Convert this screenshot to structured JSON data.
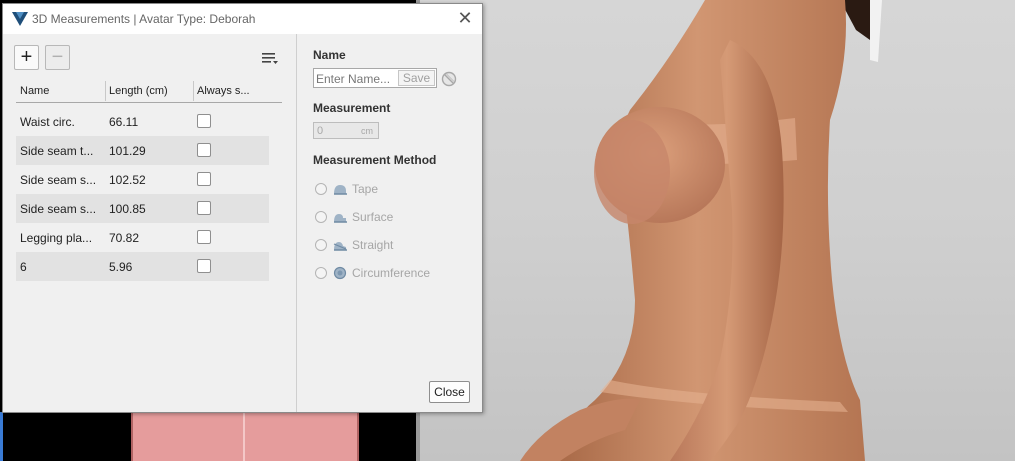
{
  "dialog": {
    "title": "3D Measurements | Avatar Type: Deborah",
    "toolbar": {
      "add_label": "+",
      "remove_label": "−"
    },
    "table": {
      "headers": [
        "Name",
        "Length (cm)",
        "Always s..."
      ],
      "rows": [
        {
          "name": "Waist circ.",
          "length": "66.11",
          "always_show": false
        },
        {
          "name": "Side seam t...",
          "length": "101.29",
          "always_show": false
        },
        {
          "name": "Side seam s...",
          "length": "102.52",
          "always_show": false
        },
        {
          "name": "Side seam s...",
          "length": "100.85",
          "always_show": false
        },
        {
          "name": "Legging pla...",
          "length": "70.82",
          "always_show": false
        },
        {
          "name": "6",
          "length": "5.96",
          "always_show": false
        }
      ]
    },
    "properties": {
      "name_label": "Name",
      "name_placeholder": "Enter Name...",
      "save_label": "Save",
      "measurement_label": "Measurement",
      "measurement_value": "0",
      "measurement_unit": "cm",
      "method_label": "Measurement Method",
      "methods": [
        {
          "label": "Tape",
          "icon": "tape-measure-icon"
        },
        {
          "label": "Surface",
          "icon": "surface-measure-icon"
        },
        {
          "label": "Straight",
          "icon": "straight-measure-icon"
        },
        {
          "label": "Circumference",
          "icon": "circumference-measure-icon"
        }
      ]
    },
    "close_label": "Close"
  },
  "colors": {
    "dialog_bg": "#f0f0f0",
    "row_alt": "#e2e2e2",
    "viewport_bg": "#cfcfcf",
    "pattern_pink": "#e59c9c",
    "skin": "#c98a66"
  }
}
